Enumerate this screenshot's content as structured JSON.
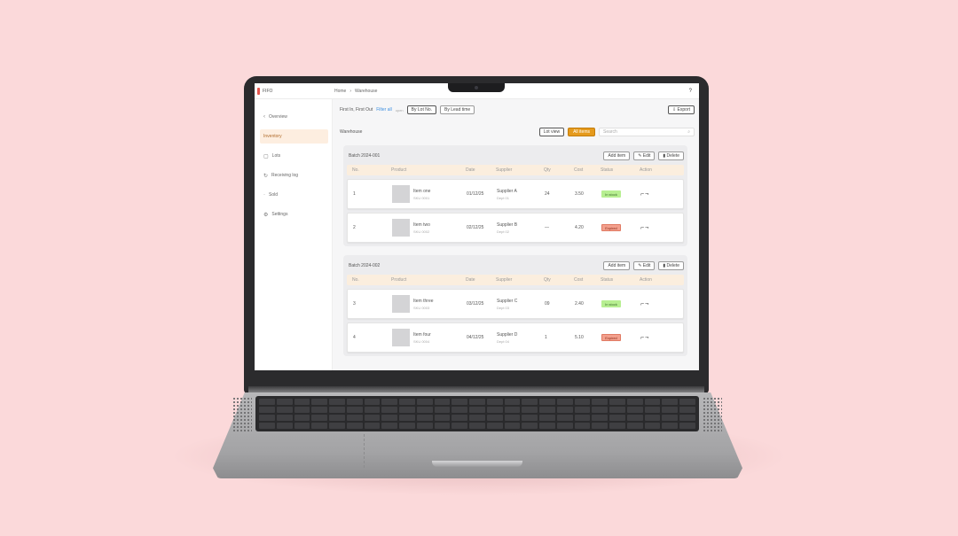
{
  "app": {
    "brand": "FIFO"
  },
  "breadcrumb": [
    "Home",
    "Warehouse"
  ],
  "topbar": {
    "user_icon": "help-icon"
  },
  "sidebar": {
    "items": [
      {
        "label": "Overview",
        "icon": "chevron-icon"
      },
      {
        "label": "Inventory",
        "icon": "box-icon",
        "active": true
      },
      {
        "label": "Lots",
        "icon": "list-icon"
      },
      {
        "label": "Receiving log",
        "icon": "receive-icon"
      },
      {
        "label": "Sold",
        "icon": "tag-icon"
      },
      {
        "label": "Settings",
        "icon": "gear-icon"
      }
    ]
  },
  "filterbar": {
    "label": "First In, First Out",
    "link": "Filter all",
    "hint": "open",
    "buttons": [
      "By Lot No.",
      "By Lead time"
    ],
    "export_label": "Export"
  },
  "toolbar": {
    "title": "Warehouse",
    "segment_label": "Lot view",
    "primary_label": "All items",
    "search_placeholder": "Search"
  },
  "groups": [
    {
      "title": "Batch 2024-001",
      "actions": [
        "Add item",
        "Edit",
        "Delete"
      ],
      "columns": [
        "No.",
        "Product",
        "Date",
        "Supplier",
        "Qty",
        "Cost",
        "Status",
        "Action"
      ],
      "rows": [
        {
          "no": "1",
          "name": "Item one",
          "sku": "SKU 0001",
          "date": "01/12/25",
          "supplier": "Supplier A",
          "supplier_sub": "Dept 01",
          "qty": "24",
          "cost": "3.50",
          "status": "In stock",
          "status_type": "green"
        },
        {
          "no": "2",
          "name": "Item two",
          "sku": "SKU 0002",
          "date": "02/12/25",
          "supplier": "Supplier B",
          "supplier_sub": "Dept 02",
          "qty": "—",
          "cost": "4.20",
          "status": "Expired",
          "status_type": "red"
        }
      ]
    },
    {
      "title": "Batch 2024-002",
      "actions": [
        "Add item",
        "Edit",
        "Delete"
      ],
      "columns": [
        "No.",
        "Product",
        "Date",
        "Supplier",
        "Qty",
        "Cost",
        "Status",
        "Action"
      ],
      "rows": [
        {
          "no": "3",
          "name": "Item three",
          "sku": "SKU 0003",
          "date": "03/12/25",
          "supplier": "Supplier C",
          "supplier_sub": "Dept 03",
          "qty": "09",
          "cost": "2.40",
          "status": "In stock",
          "status_type": "green"
        },
        {
          "no": "4",
          "name": "Item four",
          "sku": "SKU 0004",
          "date": "04/12/25",
          "supplier": "Supplier D",
          "supplier_sub": "Dept 04",
          "qty": "1",
          "cost": "5.10",
          "status": "Expired",
          "status_type": "red"
        }
      ]
    }
  ]
}
